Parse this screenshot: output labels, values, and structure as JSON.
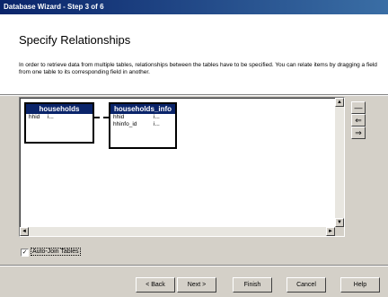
{
  "window": {
    "title": "Database Wizard - Step 3 of 6"
  },
  "header": {
    "heading": "Specify Relationships",
    "description": "In order to retrieve data from multiple tables, relationships between the tables have to be specified. You can relate items by dragging a field from one table to its corresponding field in another."
  },
  "tables": [
    {
      "name": "households",
      "fields": [
        {
          "name": "hhid",
          "type": "i..."
        }
      ]
    },
    {
      "name": "households_info",
      "fields": [
        {
          "name": "hhid",
          "type": "i..."
        },
        {
          "name": "hhinfo_id",
          "type": "i..."
        }
      ]
    }
  ],
  "side_buttons": [
    "—",
    "⇐",
    "⇒"
  ],
  "auto_join": {
    "label": "Auto-Join Tables",
    "checked": true
  },
  "buttons": {
    "back": "< Back",
    "next": "Next >",
    "finish": "Finish",
    "cancel": "Cancel",
    "help": "Help"
  },
  "colors": {
    "title_bar": "#0a246a",
    "dialog_bg": "#d4d0c8",
    "table_header": "#0a246a"
  }
}
